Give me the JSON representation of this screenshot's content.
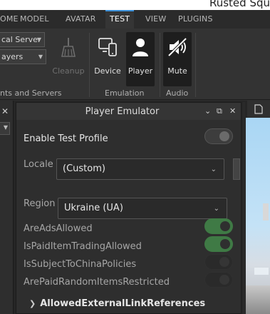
{
  "window": {
    "title": "Rusted Squ"
  },
  "tabs": [
    {
      "label": "OME",
      "active": false
    },
    {
      "label": "MODEL",
      "active": false
    },
    {
      "label": "AVATAR",
      "active": false
    },
    {
      "label": "TEST",
      "active": true
    },
    {
      "label": "VIEW",
      "active": false
    },
    {
      "label": "PLUGINS",
      "active": false
    }
  ],
  "ribbon": {
    "server_select": "cal Server",
    "players_select": "ayers",
    "group_clients_label": "nts and Servers",
    "cleanup_label": "Cleanup",
    "device_label": "Device",
    "player_label": "Player",
    "mute_label": "Mute",
    "group_emulation_label": "Emulation",
    "group_audio_label": "Audio"
  },
  "emulator": {
    "title": "Player Emulator",
    "enable_test_profile_label": "Enable Test Profile",
    "enable_test_profile_on": false,
    "locale_label": "Locale",
    "locale_value": "(Custom)",
    "region_label": "Region",
    "region_value": "Ukraine (UA)",
    "flags": [
      {
        "label": "AreAdsAllowed",
        "on": true
      },
      {
        "label": "IsPaidItemTradingAllowed",
        "on": true
      },
      {
        "label": "IsSubjectToChinaPolicies",
        "on": false
      },
      {
        "label": "ArePaidRandomItemsRestricted",
        "on": false
      }
    ],
    "section_label": "AllowedExternalLinkReferences"
  },
  "colors": {
    "accent": "#3a8fd8",
    "toggle_on": "#3f7a45",
    "panel_bg": "#2e2e2e"
  }
}
